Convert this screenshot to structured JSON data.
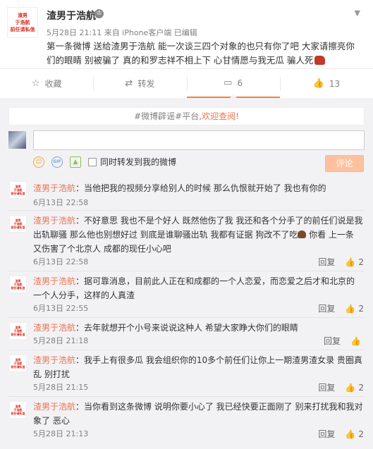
{
  "post": {
    "avatar_text": [
      "渣男",
      "于浩航",
      "前任请私信"
    ],
    "name": "渣男于浩航",
    "badge": "♔",
    "meta": "5月28日 21:11 来自 iPhone客户端   已编辑",
    "text": "第一条微博 送给渣男于浩航  能一次谈三四个对象的也只有你了吧 大家请擦亮你们的眼睛 别被骗了 真的和罗志祥不相上下 心甘情愿与我无瓜 骗人死"
  },
  "actions": [
    {
      "icon": "☆",
      "label": "收藏"
    },
    {
      "icon": "⇄",
      "label": "转发"
    },
    {
      "icon": "▭",
      "label": "6"
    },
    {
      "icon": "👍",
      "label": "13"
    }
  ],
  "notice": {
    "prefix": "#微博辟谣#平台,",
    "link": "欢迎查阅!"
  },
  "composer": {
    "placeholder": "",
    "forward_label": "同时转发到我的微博",
    "submit_label": "评论"
  },
  "comments": [
    {
      "name": "渣男于浩航",
      "text": "当他把我的视频分享给别人的时候 那么仇恨就开始了 我也有你的",
      "time": "6月13日 22:58",
      "reply": "",
      "likes": ""
    },
    {
      "name": "渣男于浩航",
      "text": "不好意思 我也不是个好人 既然他伤了我 我还和各个分手了的前任们说是我出轨聊骚  那么他也别想好过 到底是谁聊骚出轨 我都有证据 狗改不了吃",
      "text2": " 你看 上一条 又伤害了个北京人 成都的现任小心吧",
      "time": "6月13日 22:58",
      "reply": "回复",
      "likes": "2"
    },
    {
      "name": "渣男于浩航",
      "text": "据可靠消息，目前此人正在和成都的一个人恋爱，而恋爱之后才和北京的一个人分手，这样的人真渣",
      "time": "6月13日 22:55",
      "reply": "回复",
      "likes": "2"
    },
    {
      "name": "渣男于浩航",
      "text": "去年就想开个小号来说说这种人 希望大家睁大你们的眼睛",
      "time": "5月28日 21:18",
      "reply": "回复",
      "likes": ""
    },
    {
      "name": "渣男于浩航",
      "text": "我手上有很多瓜 我会组织你的10多个前任们让你上一期渣男渣女录 贵圈真乱 别打扰",
      "time": "5月28日 21:15",
      "reply": "回复",
      "likes": "2"
    },
    {
      "name": "渣男于浩航",
      "text": "当你看到这条微博 说明你要小心了 我已经快要正面刚了 别来打扰我和我对象了 恶心",
      "time": "5月28日 21:13",
      "reply": "回复",
      "likes": "2"
    }
  ]
}
